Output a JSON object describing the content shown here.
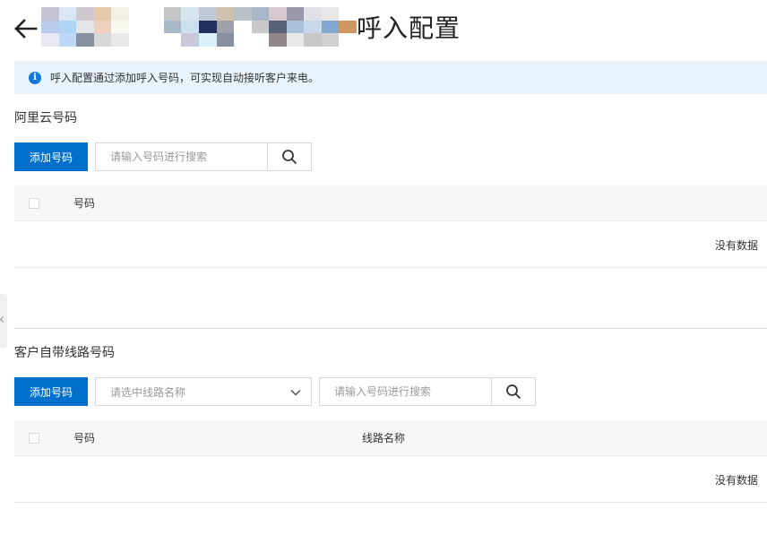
{
  "header": {
    "back_icon": "arrow-left-icon",
    "title": "呼入配置",
    "mosaic_colors": [
      "#c3c3d3",
      "#d8e6f5",
      "#cfc8cf",
      "#e8c9aa",
      "#f4f0e8",
      "#ffffff",
      "#ffffff",
      "#c5c5c5",
      "#d4e5f0",
      "#c0c8d8",
      "#cfc0b0",
      "#b8c0c8",
      "#a8b8c8",
      "#d8c8d0",
      "#9898a8",
      "#e0e0e8",
      "#e8e8e8",
      "#ffffff",
      "#b8cbe8",
      "#b0d4f4",
      "#e4e4e4",
      "#efd0c0",
      "#f8f8f0",
      "#ffffff",
      "#ffffff",
      "#a8b8c8",
      "#c8e0f0",
      "#203060",
      "#a0a0a8",
      "#ffffff",
      "#c8c8c8",
      "#586078",
      "#a8c0d8",
      "#c8d8e8",
      "#80a8d0",
      "#d09860",
      "#e8e8f0",
      "#c0d8f8",
      "#8890a0",
      "#d8d8d8",
      "#e8e8e8",
      "#ffffff",
      "#ffffff",
      "#ffffff",
      "#c8c8d8",
      "#d8f0f8",
      "#8890a0",
      "#ffffff",
      "#ffffff",
      "#908888",
      "#e8e8e8",
      "#c8c8c8",
      "#d0d0d0",
      "#ffffff"
    ]
  },
  "notice": {
    "icon": "info-icon",
    "text": "呼入配置通过添加呼入号码，可实现自动接听客户来电。"
  },
  "aliyun": {
    "title": "阿里云号码",
    "add_button": "添加号码",
    "search_placeholder": "请输入号码进行搜索",
    "search_icon": "search-icon",
    "col_number": "号码",
    "empty": "没有数据"
  },
  "custom": {
    "title": "客户自带线路号码",
    "add_button": "添加号码",
    "line_select_placeholder": "请选中线路名称",
    "search_placeholder": "请输入号码进行搜索",
    "search_icon": "search-icon",
    "col_number": "号码",
    "col_line": "线路名称",
    "empty": "没有数据"
  },
  "colors": {
    "primary": "#0070cc",
    "notice_bg": "#e8f3fc",
    "info": "#1479d7"
  }
}
